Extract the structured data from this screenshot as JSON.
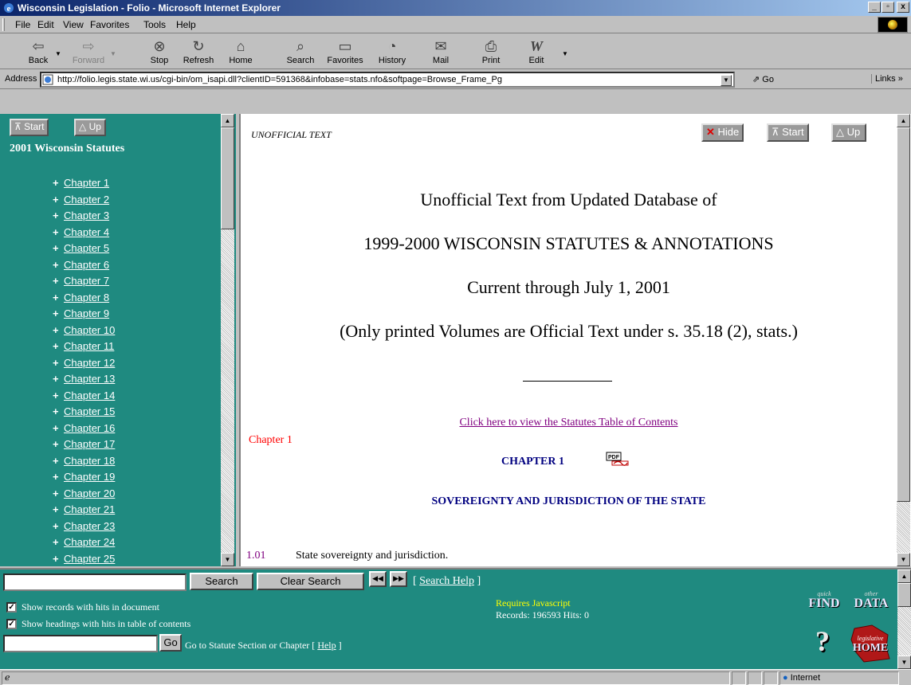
{
  "window": {
    "title": "Wisconsin Legislation - Folio - Microsoft Internet Explorer",
    "buttons": [
      "_",
      "▫",
      "x"
    ]
  },
  "menu": {
    "items": [
      {
        "label": "File"
      },
      {
        "label": "Edit"
      },
      {
        "label": "View"
      },
      {
        "label": "Favorites"
      },
      {
        "label": "Tools"
      },
      {
        "label": "Help"
      }
    ]
  },
  "toolbar": {
    "back": "Back",
    "forward": "Forward",
    "stop": "Stop",
    "refresh": "Refresh",
    "home": "Home",
    "search": "Search",
    "favorites": "Favorites",
    "history": "History",
    "mail": "Mail",
    "print": "Print",
    "edit": "Edit"
  },
  "address": {
    "label": "Address",
    "url": "http://folio.legis.state.wi.us/cgi-bin/om_isapi.dll?clientID=591368&infobase=stats.nfo&softpage=Browse_Frame_Pg",
    "go": "Go",
    "links": "Links »"
  },
  "left": {
    "start_btn": "Start",
    "up_btn": "Up",
    "title": "2001 Wisconsin Statutes",
    "chapters": [
      "Chapter 1",
      "Chapter 2",
      "Chapter 3",
      "Chapter 4",
      "Chapter 5",
      "Chapter 6",
      "Chapter 7",
      "Chapter 8",
      "Chapter 9",
      "Chapter 10",
      "Chapter 11",
      "Chapter 12",
      "Chapter 13",
      "Chapter 14",
      "Chapter 15",
      "Chapter 16",
      "Chapter 17",
      "Chapter 18",
      "Chapter 19",
      "Chapter 20",
      "Chapter 21",
      "Chapter 23",
      "Chapter 24",
      "Chapter 25"
    ]
  },
  "main": {
    "unofficial": "UNOFFICIAL TEXT",
    "hide_btn": "Hide",
    "start_btn": "Start",
    "up_btn": "Up",
    "line1": "Unofficial Text from Updated Database of",
    "line2": "1999-2000 WISCONSIN STATUTES & ANNOTATIONS",
    "line3": "Current through July 1, 2001",
    "line4": "(Only printed Volumes are Official Text under s. 35.18 (2), stats.)",
    "toc_link": "Click here to view the Statutes Table of Contents",
    "chapter_marker": "Chapter 1",
    "chapter_heading": "CHAPTER 1",
    "sovereignty_heading": "SOVEREIGNTY AND JURISDICTION OF THE STATE",
    "section_number": "1.01",
    "section_title": "State sovereignty and jurisdiction."
  },
  "bottom": {
    "search_btn": "Search",
    "clear_btn": "Clear Search",
    "search_help_open": "[ ",
    "search_help": "Search Help",
    "search_help_close": " ]",
    "show_records": "Show records with hits in document",
    "show_headings": "Show headings with hits in table of contents",
    "requires_js": "Requires Javascript",
    "records": "Records: 196593 Hits: 0",
    "go_btn": "Go",
    "goto_text": "Go to Statute Section or Chapter [",
    "goto_help": "Help",
    "goto_close": "]",
    "quick_find_small": "quick",
    "quick_find_big": "FIND",
    "other_data_small": "other",
    "other_data_big": "DATA",
    "home_small": "legislative",
    "home_big": "HOME"
  },
  "status": {
    "zone": "Internet"
  }
}
